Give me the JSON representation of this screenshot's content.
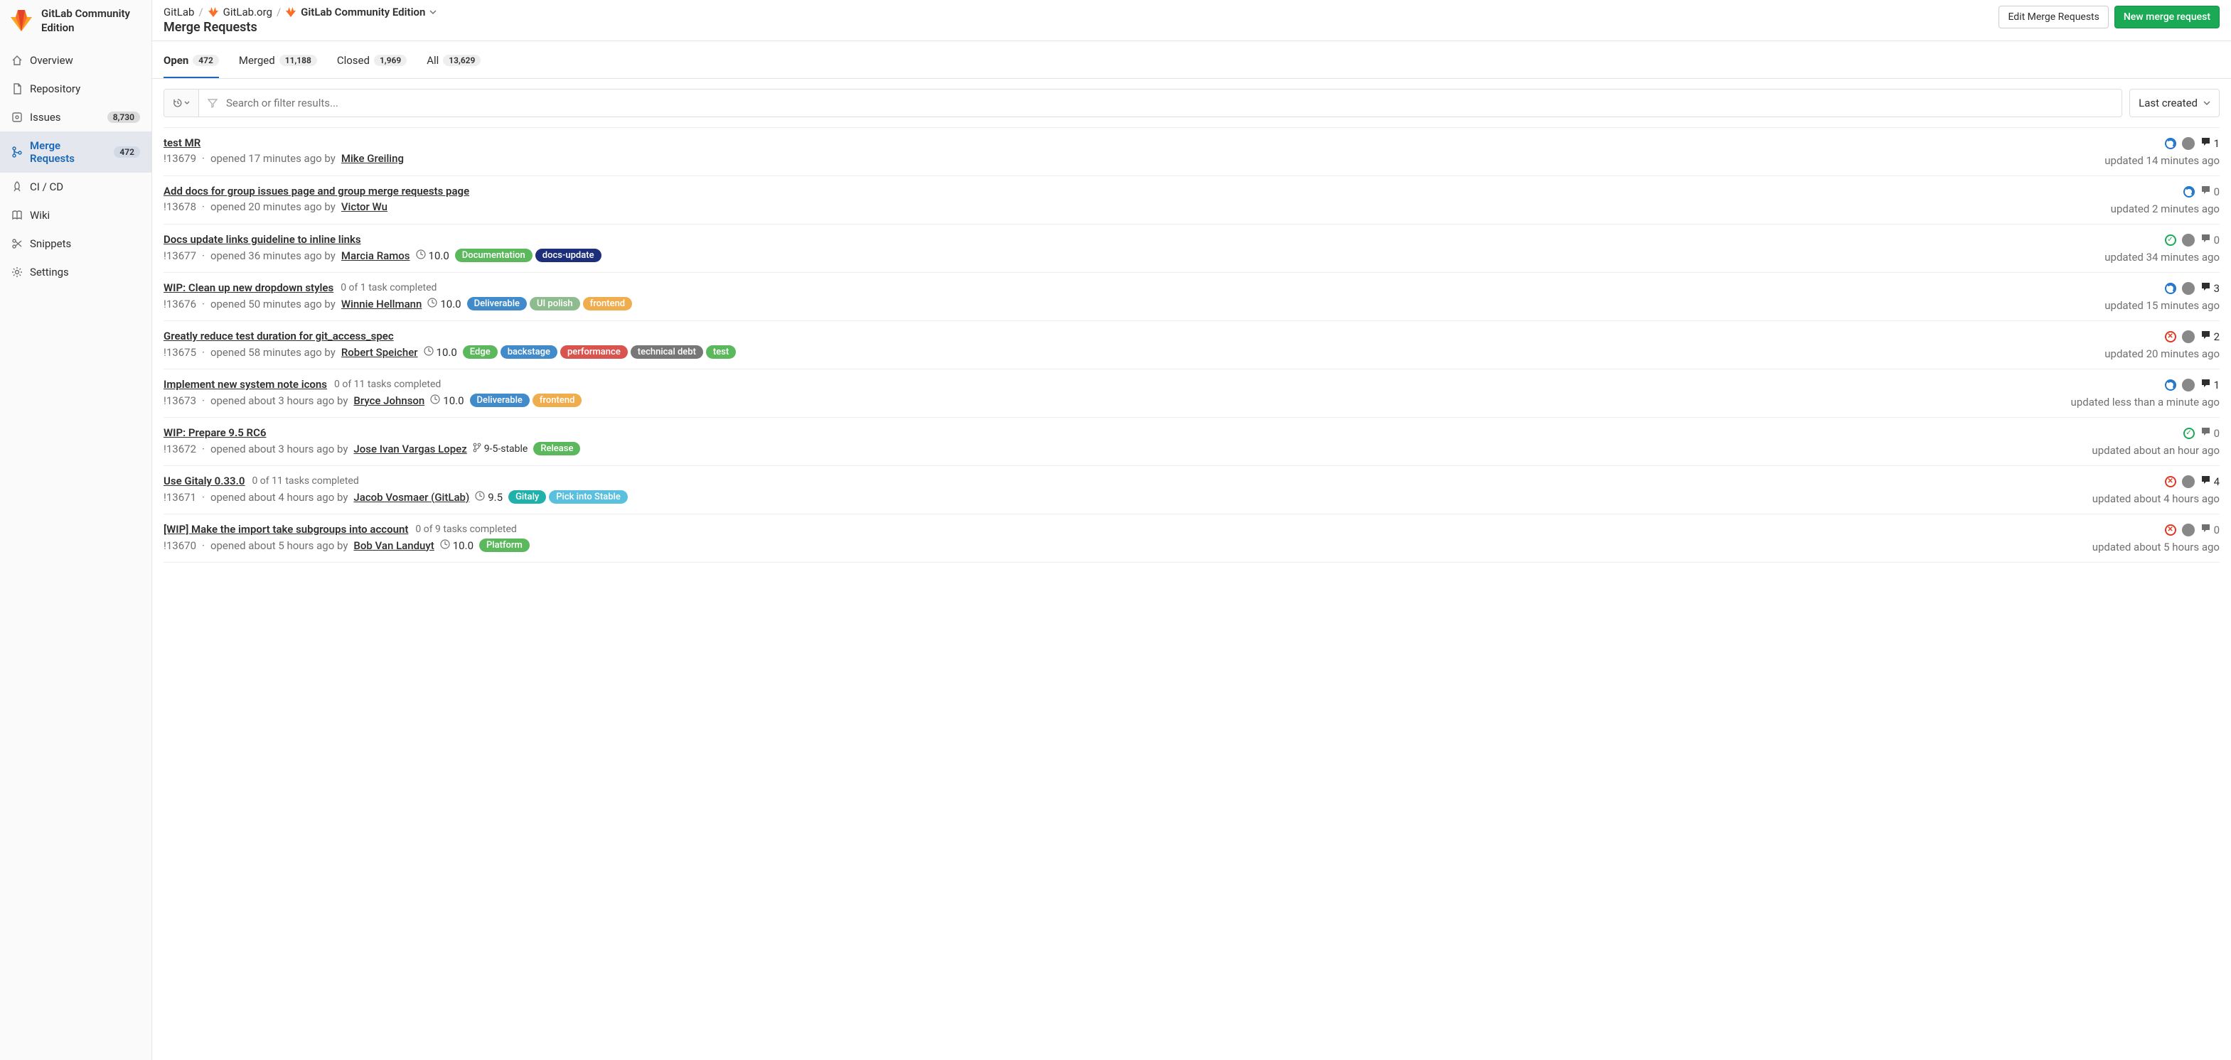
{
  "project_title": "GitLab Community Edition",
  "breadcrumb": {
    "items": [
      "GitLab",
      "GitLab.org",
      "GitLab Community Edition"
    ]
  },
  "page_heading": "Merge Requests",
  "actions": {
    "edit": "Edit Merge Requests",
    "new": "New merge request"
  },
  "sidebar": {
    "items": [
      {
        "label": "Overview",
        "icon": "home-icon",
        "badge": null,
        "active": false
      },
      {
        "label": "Repository",
        "icon": "file-icon",
        "badge": null,
        "active": false
      },
      {
        "label": "Issues",
        "icon": "issues-icon",
        "badge": "8,730",
        "active": false
      },
      {
        "label": "Merge Requests",
        "icon": "merge-icon",
        "badge": "472",
        "active": true
      },
      {
        "label": "CI / CD",
        "icon": "rocket-icon",
        "badge": null,
        "active": false
      },
      {
        "label": "Wiki",
        "icon": "book-icon",
        "badge": null,
        "active": false
      },
      {
        "label": "Snippets",
        "icon": "scissors-icon",
        "badge": null,
        "active": false
      },
      {
        "label": "Settings",
        "icon": "gear-icon",
        "badge": null,
        "active": false
      }
    ]
  },
  "tabs": [
    {
      "label": "Open",
      "count": "472",
      "active": true
    },
    {
      "label": "Merged",
      "count": "11,188",
      "active": false
    },
    {
      "label": "Closed",
      "count": "1,969",
      "active": false
    },
    {
      "label": "All",
      "count": "13,629",
      "active": false
    }
  ],
  "filter": {
    "placeholder": "Search or filter results...",
    "sort": "Last created"
  },
  "label_colors": {
    "Documentation": "#5cb85c",
    "docs-update": "#1d2f7b",
    "Deliverable": "#428bca",
    "UI polish": "#8fbc8f",
    "frontend": "#f0ad4e",
    "Edge": "#5cb85c",
    "backstage": "#428bca",
    "performance": "#d9534f",
    "technical debt": "#777777",
    "test": "#5cb85c",
    "Release": "#5cb85c",
    "Gitaly": "#20b2aa",
    "Pick into Stable": "#5bc0de",
    "Platform": "#5cb85c"
  },
  "mrs": [
    {
      "title": "test MR",
      "task": null,
      "ref": "!13679",
      "opened": "opened 17 minutes ago by",
      "author": "Mike Greiling",
      "milestone": null,
      "branch": null,
      "labels": [],
      "pipeline": "running",
      "assignee": true,
      "comments": 1,
      "updated": "updated 14 minutes ago"
    },
    {
      "title": "Add docs for group issues page and group merge requests page",
      "task": null,
      "ref": "!13678",
      "opened": "opened 20 minutes ago by",
      "author": "Victor Wu",
      "milestone": null,
      "branch": null,
      "labels": [],
      "pipeline": "running",
      "assignee": false,
      "comments": 0,
      "updated": "updated 2 minutes ago"
    },
    {
      "title": "Docs update links guideline to inline links",
      "task": null,
      "ref": "!13677",
      "opened": "opened 36 minutes ago by",
      "author": "Marcia Ramos",
      "milestone": "10.0",
      "branch": null,
      "labels": [
        "Documentation",
        "docs-update"
      ],
      "pipeline": "passed",
      "assignee": true,
      "comments": 0,
      "updated": "updated 34 minutes ago"
    },
    {
      "title": "WIP: Clean up new dropdown styles",
      "task": "0 of 1 task completed",
      "ref": "!13676",
      "opened": "opened 50 minutes ago by",
      "author": "Winnie Hellmann",
      "milestone": "10.0",
      "branch": null,
      "labels": [
        "Deliverable",
        "UI polish",
        "frontend"
      ],
      "pipeline": "running",
      "assignee": true,
      "comments": 3,
      "updated": "updated 15 minutes ago"
    },
    {
      "title": "Greatly reduce test duration for git_access_spec",
      "task": null,
      "ref": "!13675",
      "opened": "opened 58 minutes ago by",
      "author": "Robert Speicher",
      "milestone": "10.0",
      "branch": null,
      "labels": [
        "Edge",
        "backstage",
        "performance",
        "technical debt",
        "test"
      ],
      "pipeline": "failed",
      "assignee": true,
      "comments": 2,
      "updated": "updated 20 minutes ago"
    },
    {
      "title": "Implement new system note icons",
      "task": "0 of 11 tasks completed",
      "ref": "!13673",
      "opened": "opened about 3 hours ago by",
      "author": "Bryce Johnson",
      "milestone": "10.0",
      "branch": null,
      "labels": [
        "Deliverable",
        "frontend"
      ],
      "pipeline": "running",
      "assignee": true,
      "comments": 1,
      "updated": "updated less than a minute ago"
    },
    {
      "title": "WIP: Prepare 9.5 RC6",
      "task": null,
      "ref": "!13672",
      "opened": "opened about 3 hours ago by",
      "author": "Jose Ivan Vargas Lopez",
      "milestone": null,
      "branch": "9-5-stable",
      "labels": [
        "Release"
      ],
      "pipeline": "passed",
      "assignee": false,
      "comments": 0,
      "updated": "updated about an hour ago"
    },
    {
      "title": "Use Gitaly 0.33.0",
      "task": "0 of 11 tasks completed",
      "ref": "!13671",
      "opened": "opened about 4 hours ago by",
      "author": "Jacob Vosmaer (GitLab)",
      "milestone": "9.5",
      "branch": null,
      "labels": [
        "Gitaly",
        "Pick into Stable"
      ],
      "pipeline": "failed",
      "assignee": true,
      "comments": 4,
      "updated": "updated about 4 hours ago"
    },
    {
      "title": "[WIP] Make the import take subgroups into account",
      "task": "0 of 9 tasks completed",
      "ref": "!13670",
      "opened": "opened about 5 hours ago by",
      "author": "Bob Van Landuyt",
      "milestone": "10.0",
      "branch": null,
      "labels": [
        "Platform"
      ],
      "pipeline": "failed",
      "assignee": true,
      "comments": 0,
      "updated": "updated about 5 hours ago"
    }
  ]
}
